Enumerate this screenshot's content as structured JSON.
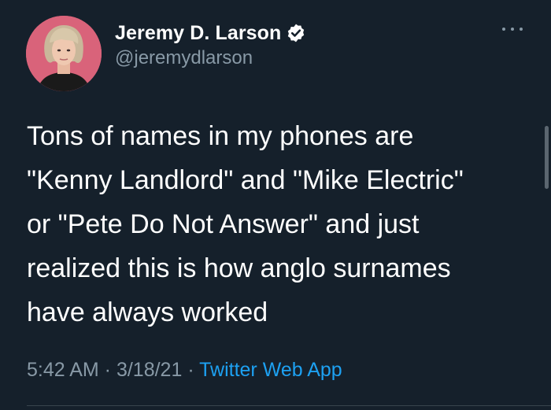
{
  "author": {
    "display_name": "Jeremy D. Larson",
    "handle": "@jeremydlarson",
    "verified": true,
    "avatar_icon": "profile-photo"
  },
  "tweet": {
    "text": "Tons of names in my phones are\n\"Kenny Landlord\" and \"Mike Electric\"\nor \"Pete Do Not Answer\" and just\nrealized this is how anglo surnames\nhave always worked"
  },
  "meta": {
    "time": "5:42 AM",
    "date": "3/18/21",
    "separator": " · ",
    "source": "Twitter Web App"
  },
  "colors": {
    "background": "#15202b",
    "text": "#ffffff",
    "muted": "#8899a6",
    "link": "#1da1f2"
  },
  "icons": {
    "more": "more-dots-icon",
    "verified": "verified-badge-icon"
  }
}
